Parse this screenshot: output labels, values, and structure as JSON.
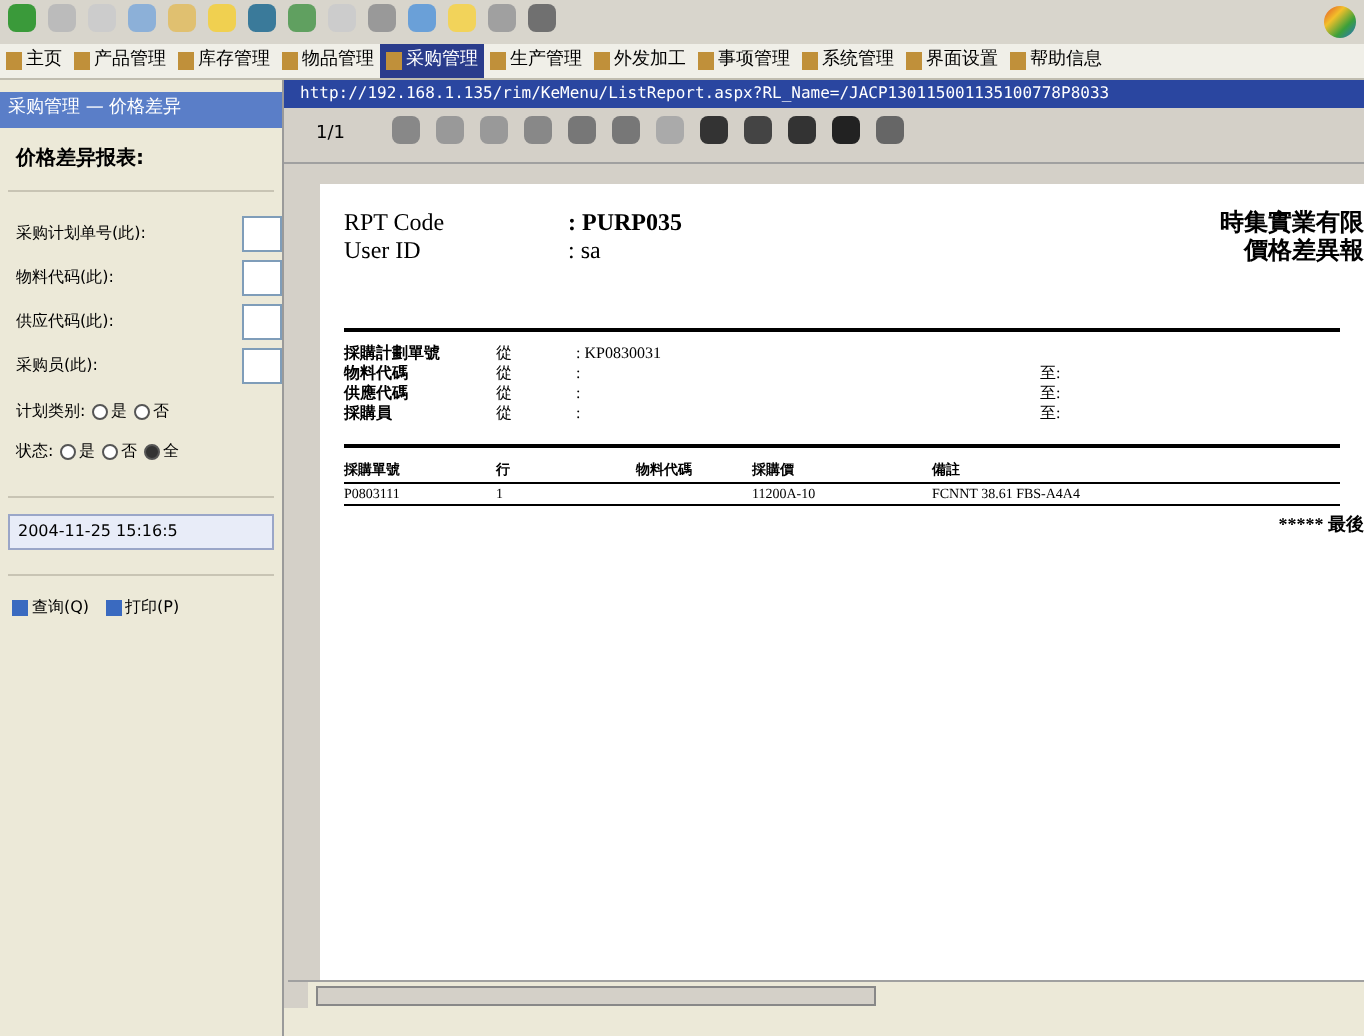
{
  "tabs": [
    {
      "label": "主页",
      "selected": false
    },
    {
      "label": "产品管理",
      "selected": false
    },
    {
      "label": "库存管理",
      "selected": false
    },
    {
      "label": "物品管理",
      "selected": false
    },
    {
      "label": "采购管理",
      "selected": true
    },
    {
      "label": "生产管理",
      "selected": false
    },
    {
      "label": "外发加工",
      "selected": false
    },
    {
      "label": "事项管理",
      "selected": false
    },
    {
      "label": "系统管理",
      "selected": false
    },
    {
      "label": "界面设置",
      "selected": false
    },
    {
      "label": "帮助信息",
      "selected": false
    }
  ],
  "panel": {
    "title": "采购管理 — 价格差异",
    "heading": "价格差异报表:",
    "fields": [
      {
        "label": "采购计划单号(此):"
      },
      {
        "label": "物料代码(此):"
      },
      {
        "label": "供应代码(此):"
      },
      {
        "label": "采购员(此):"
      }
    ],
    "radio_groups": [
      {
        "label": "计划类别:",
        "options": [
          {
            "label": "是",
            "selected": false
          },
          {
            "label": "否",
            "selected": false
          }
        ]
      },
      {
        "label": "状态:",
        "options": [
          {
            "label": "是",
            "selected": false
          },
          {
            "label": "否",
            "selected": false
          },
          {
            "label": "全",
            "selected": true
          }
        ]
      }
    ],
    "date_value": "2004-11-25 15:16:5",
    "buttons": [
      "查询(Q)",
      "打印(P)"
    ]
  },
  "report_window": {
    "title": "http://192.168.1.135/rim/KeMenu/ListReport.aspx?RL_Name=/JACP130115001135100778P8033",
    "page_indicator": "1/1",
    "rpt_code_label": "RPT Code",
    "rpt_code": ": PURP035",
    "user_id_label": "User ID",
    "user_id": ": sa",
    "company": "時集實業有限",
    "report_title": "價格差異報",
    "info_rows": [
      {
        "label": "採購計劃單號",
        "from": "從",
        "value": ": KP0830031",
        "to": ""
      },
      {
        "label": "物料代碼",
        "from": "從",
        "value": ":",
        "to": "至:"
      },
      {
        "label": "供應代碼",
        "from": "從",
        "value": ":",
        "to": "至:"
      },
      {
        "label": "採購員",
        "from": "從",
        "value": ":",
        "to": "至:"
      }
    ],
    "columns": [
      "採購單號",
      "行",
      "物料代碼",
      "採購價",
      "備註"
    ],
    "rows": [
      [
        "P0803111",
        "1",
        "",
        "11200A-10",
        "FCNNT 38.61 FBS-A4A4"
      ]
    ],
    "footer": "***** 最後"
  }
}
